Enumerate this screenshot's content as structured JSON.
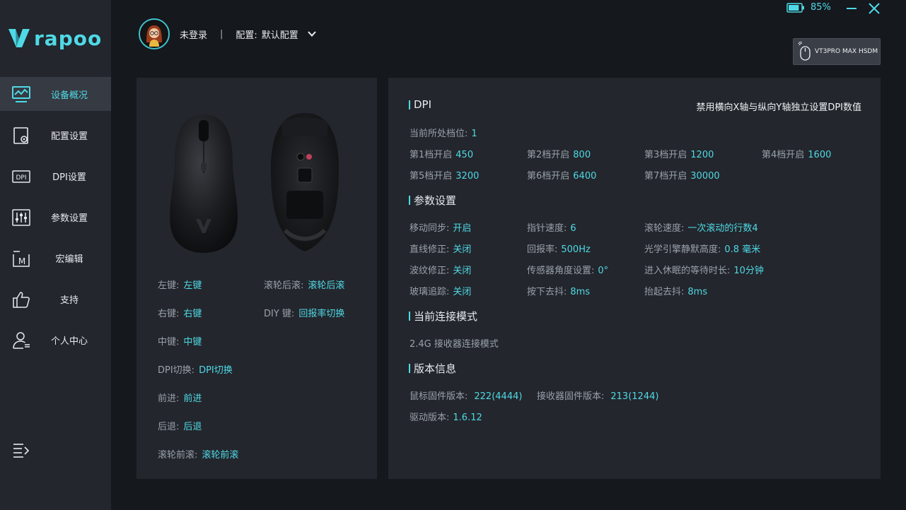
{
  "app": {
    "logo_text": "rapoo",
    "battery_pct": "85%",
    "battery_level": 0.85,
    "accent_color": "#4fd9e6"
  },
  "sidebar": {
    "items": [
      {
        "label": "设备概况",
        "icon": "monitor-chart-icon",
        "active": true
      },
      {
        "label": "配置设置",
        "icon": "settings-file-icon"
      },
      {
        "label": "DPI设置",
        "icon": "dpi-icon"
      },
      {
        "label": "参数设置",
        "icon": "sliders-icon"
      },
      {
        "label": "宏编辑",
        "icon": "macro-icon"
      },
      {
        "label": "支持",
        "icon": "thumbs-up-icon"
      },
      {
        "label": "个人中心",
        "icon": "user-icon"
      }
    ]
  },
  "header": {
    "user": "未登录",
    "divider": "|",
    "config_label": "配置:",
    "config_value": "默认配置"
  },
  "device": {
    "name": "VT3PRO MAX HSDM"
  },
  "buttons": {
    "left": [
      {
        "key": "左键:",
        "value": "左键"
      },
      {
        "key": "右键:",
        "value": "右键"
      },
      {
        "key": "中键:",
        "value": "中键"
      },
      {
        "key": "DPI切换:",
        "value": "DPI切换"
      },
      {
        "key": "前进:",
        "value": "前进"
      },
      {
        "key": "后退:",
        "value": "后退"
      },
      {
        "key": "滚轮前滚:",
        "value": "滚轮前滚"
      }
    ],
    "right": [
      {
        "key": "滚轮后滚:",
        "value": "滚轮后滚"
      },
      {
        "key": "DIY 键:",
        "value": "回报率切换"
      }
    ]
  },
  "dpi": {
    "title": "DPI",
    "note": "禁用横向X轴与纵向Y轴独立设置DPI数值",
    "current_label": "当前所处档位:",
    "current_value": "1",
    "levels": [
      {
        "label": "第1档开启",
        "value": "450"
      },
      {
        "label": "第2档开启",
        "value": "800"
      },
      {
        "label": "第3档开启",
        "value": "1200"
      },
      {
        "label": "第4档开启",
        "value": "1600"
      },
      {
        "label": "第5档开启",
        "value": "3200"
      },
      {
        "label": "第6档开启",
        "value": "6400"
      },
      {
        "label": "第7档开启",
        "value": "30000"
      }
    ]
  },
  "params": {
    "title": "参数设置",
    "items": [
      {
        "label": "移动同步:",
        "value": "开启"
      },
      {
        "label": "指针速度:",
        "value": "6"
      },
      {
        "label": "滚轮速度:",
        "value": "一次滚动的行数4"
      },
      {
        "label": "直线修正:",
        "value": "关闭"
      },
      {
        "label": "回报率:",
        "value": "500Hz"
      },
      {
        "label": "光学引擎静默高度:",
        "value": "0.8 毫米"
      },
      {
        "label": "波纹修正:",
        "value": "关闭"
      },
      {
        "label": "传感器角度设置:",
        "value": "0°"
      },
      {
        "label": "进入休眠的等待时长:",
        "value": "10分钟"
      },
      {
        "label": "玻璃追踪:",
        "value": "关闭"
      },
      {
        "label": "按下去抖:",
        "value": "8ms"
      },
      {
        "label": "抬起去抖:",
        "value": "8ms"
      }
    ]
  },
  "connection": {
    "title": "当前连接模式",
    "mode": "2.4G 接收器连接模式"
  },
  "version": {
    "title": "版本信息",
    "mouse_fw_label": "鼠标固件版本:",
    "mouse_fw_value": "222(4444)",
    "receiver_fw_label": "接收器固件版本:",
    "receiver_fw_value": "213(1244)",
    "driver_label": "驱动版本:",
    "driver_value": "1.6.12"
  }
}
